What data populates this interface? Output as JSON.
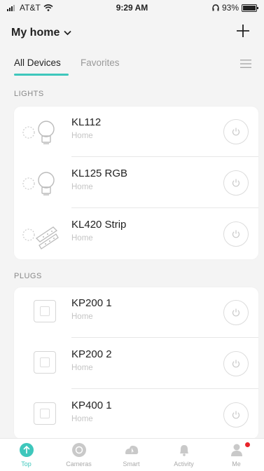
{
  "status_bar": {
    "carrier": "AT&T",
    "time": "9:29 AM",
    "battery": "93%"
  },
  "header": {
    "title": "My home"
  },
  "tabs": {
    "all": "All Devices",
    "favorites": "Favorites"
  },
  "sections": [
    {
      "label": "LIGHTS",
      "devices": [
        {
          "name": "KL112",
          "location": "Home",
          "icon": "bulb-icon"
        },
        {
          "name": "KL125 RGB",
          "location": "Home",
          "icon": "bulb-icon"
        },
        {
          "name": "KL420 Strip",
          "location": "Home",
          "icon": "light-strip-icon"
        }
      ]
    },
    {
      "label": "PLUGS",
      "devices": [
        {
          "name": "KP200 1",
          "location": "Home",
          "icon": "outlet-icon"
        },
        {
          "name": "KP200 2",
          "location": "Home",
          "icon": "outlet-icon"
        },
        {
          "name": "KP400 1",
          "location": "Home",
          "icon": "outlet-icon"
        }
      ]
    }
  ],
  "tabbar": {
    "items": [
      {
        "label": "Top",
        "icon": "arrow-up-icon",
        "active": true
      },
      {
        "label": "Cameras",
        "icon": "camera-icon",
        "active": false
      },
      {
        "label": "Smart",
        "icon": "smart-icon",
        "active": false
      },
      {
        "label": "Activity",
        "icon": "bell-icon",
        "active": false
      },
      {
        "label": "Me",
        "icon": "person-icon",
        "active": false,
        "notification": true
      }
    ]
  },
  "colors": {
    "accent": "#3ec7bc",
    "notification": "#e8242b",
    "background": "#f4f4f4"
  }
}
